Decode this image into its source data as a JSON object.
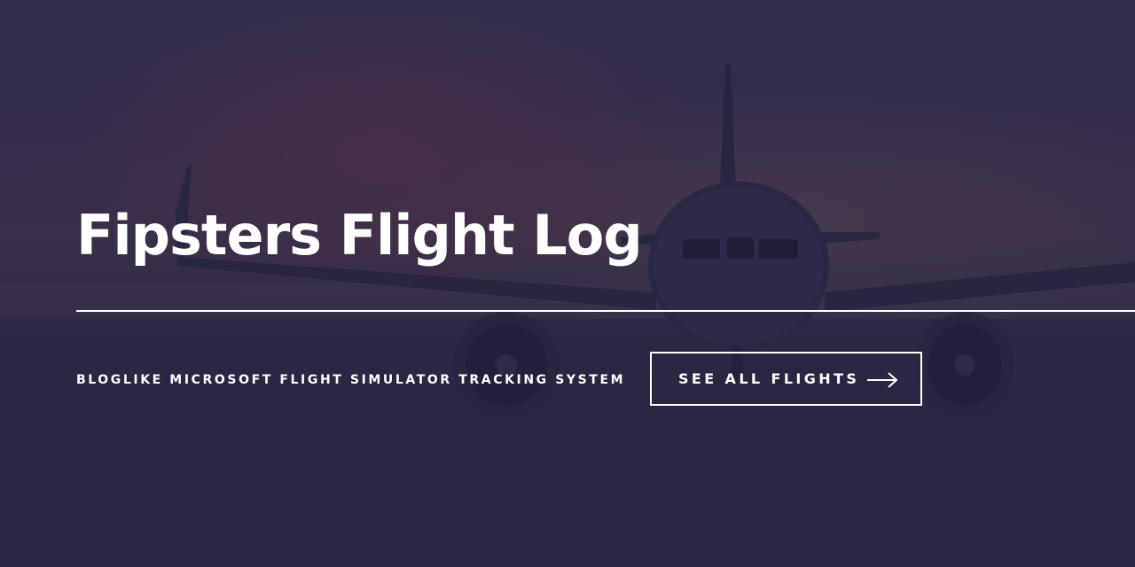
{
  "hero": {
    "title": "Fipsters Flight Log",
    "tagline": "BLOGLIKE MICROSOFT FLIGHT SIMULATOR TRACKING SYSTEM",
    "cta_label": "SEE ALL FLIGHTS",
    "cta_icon": "arrow-right-icon",
    "background_image": "airplane-at-dusk-photo"
  },
  "colors": {
    "text": "#ffffff",
    "overlay": "#23203e",
    "sky_top": "#3a3550",
    "sky_glow": "#6e374b"
  }
}
